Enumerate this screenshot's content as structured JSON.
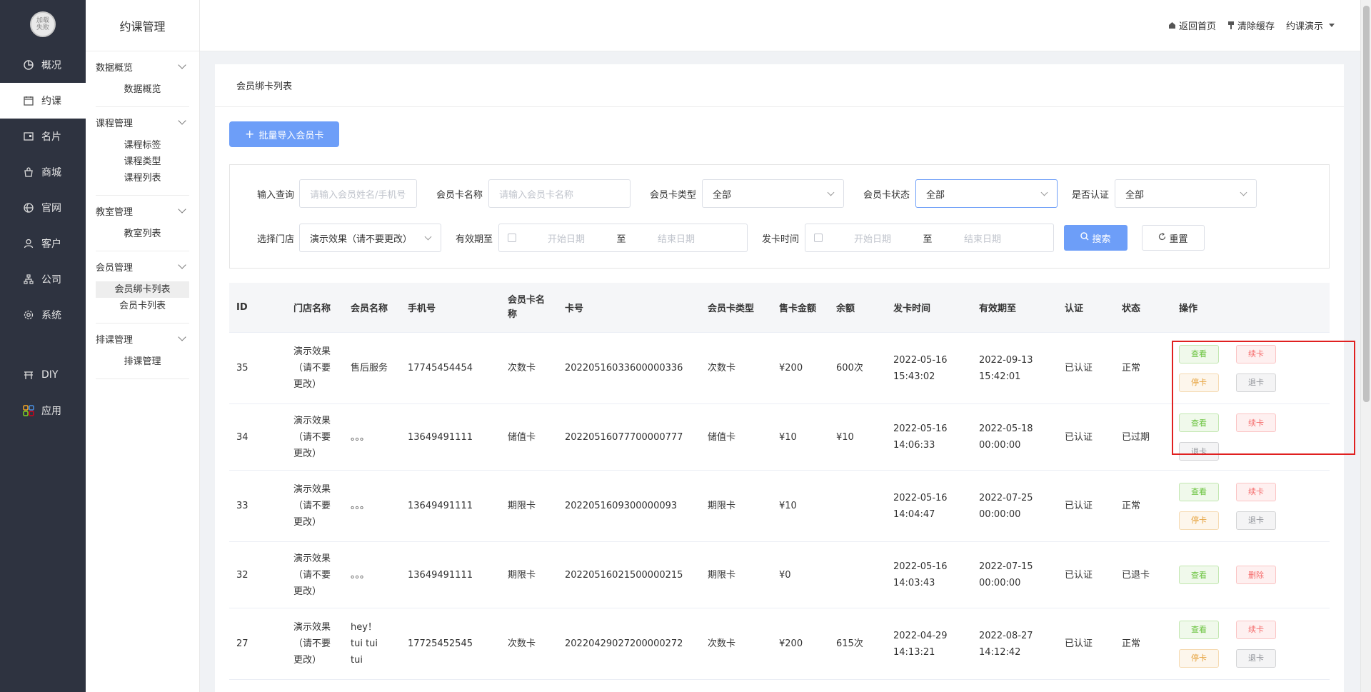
{
  "nav": {
    "logo_text": "加载\n失败",
    "items": [
      {
        "label": "概况",
        "icon": "pie-chart-icon"
      },
      {
        "label": "约课",
        "icon": "calendar-icon"
      },
      {
        "label": "名片",
        "icon": "card-icon"
      },
      {
        "label": "商城",
        "icon": "shop-icon"
      },
      {
        "label": "官网",
        "icon": "globe-icon"
      },
      {
        "label": "客户",
        "icon": "user-icon"
      },
      {
        "label": "公司",
        "icon": "org-icon"
      },
      {
        "label": "系统",
        "icon": "gear-icon"
      },
      {
        "label": "DIY",
        "icon": "diy-icon"
      },
      {
        "label": "应用",
        "icon": "apps-icon"
      }
    ],
    "active": "约课"
  },
  "subnav": {
    "title": "约课管理",
    "groups": [
      {
        "label": "数据概览",
        "items": [
          "数据概览"
        ]
      },
      {
        "label": "课程管理",
        "items": [
          "课程标签",
          "课程类型",
          "课程列表"
        ]
      },
      {
        "label": "教室管理",
        "items": [
          "教室列表"
        ]
      },
      {
        "label": "会员管理",
        "items": [
          "会员绑卡列表",
          "会员卡列表"
        ]
      },
      {
        "label": "排课管理",
        "items": [
          "排课管理"
        ]
      }
    ],
    "active_item": "会员绑卡列表"
  },
  "header": {
    "home": "返回首页",
    "clear_cache": "清除缓存",
    "user": "约课演示"
  },
  "page": {
    "title": "会员绑卡列表",
    "import_button": "批量导入会员卡"
  },
  "filters": {
    "query_label": "输入查询",
    "query_placeholder": "请输入会员姓名/手机号",
    "card_name_label": "会员卡名称",
    "card_name_placeholder": "请输入会员卡名称",
    "card_type_label": "会员卡类型",
    "card_type_value": "全部",
    "card_status_label": "会员卡状态",
    "card_status_value": "全部",
    "verified_label": "是否认证",
    "verified_value": "全部",
    "store_label": "选择门店",
    "store_value": "演示效果（请不要更改）",
    "valid_label": "有效期至",
    "issue_label": "发卡时间",
    "start_placeholder": "开始日期",
    "to": "至",
    "end_placeholder": "结束日期",
    "search_button": "搜索",
    "reset_button": "重置"
  },
  "table": {
    "headers": [
      "ID",
      "门店名称",
      "会员名称",
      "手机号",
      "会员卡名称",
      "卡号",
      "会员卡类型",
      "售卡金额",
      "余额",
      "发卡时间",
      "有效期至",
      "认证",
      "状态",
      "操作"
    ],
    "rows": [
      {
        "id": "35",
        "store": "演示效果（请不要更改）",
        "member": "售后服务",
        "phone": "17745454454",
        "card_name": "次数卡",
        "card_no": "20220516033600000336",
        "card_type": "次数卡",
        "price": "¥200",
        "balance": "600次",
        "issued": "2022-05-16 15:43:02",
        "valid": "2022-09-13 15:42:01",
        "verified": "已认证",
        "status": "正常",
        "ops": [
          "查看",
          "续卡",
          "停卡",
          "退卡"
        ]
      },
      {
        "id": "34",
        "store": "演示效果（请不要更改）",
        "member": "。。。",
        "phone": "13649491111",
        "card_name": "储值卡",
        "card_no": "20220516077700000777",
        "card_type": "储值卡",
        "price": "¥10",
        "balance": "¥10",
        "issued": "2022-05-16 14:06:33",
        "valid": "2022-05-18 00:00:00",
        "verified": "已认证",
        "status": "已过期",
        "ops": [
          "查看",
          "续卡",
          "退卡"
        ]
      },
      {
        "id": "33",
        "store": "演示效果（请不要更改）",
        "member": "。。。",
        "phone": "13649491111",
        "card_name": "期限卡",
        "card_no": "2022051609300000093",
        "card_type": "期限卡",
        "price": "¥10",
        "balance": "",
        "issued": "2022-05-16 14:04:47",
        "valid": "2022-07-25 00:00:00",
        "verified": "已认证",
        "status": "正常",
        "ops": [
          "查看",
          "续卡",
          "停卡",
          "退卡"
        ]
      },
      {
        "id": "32",
        "store": "演示效果（请不要更改）",
        "member": "。。。",
        "phone": "13649491111",
        "card_name": "期限卡",
        "card_no": "20220516021500000215",
        "card_type": "期限卡",
        "price": "¥0",
        "balance": "",
        "issued": "2022-05-16 14:03:43",
        "valid": "2022-07-15 00:00:00",
        "verified": "已认证",
        "status": "已退卡",
        "ops": [
          "查看",
          "删除"
        ]
      },
      {
        "id": "27",
        "store": "演示效果（请不要更改）",
        "member": "hey！ tui tui tui",
        "phone": "17725452545",
        "card_name": "次数卡",
        "card_no": "20220429027200000272",
        "card_type": "次数卡",
        "price": "¥200",
        "balance": "615次",
        "issued": "2022-04-29 14:13:21",
        "valid": "2022-08-27 14:12:42",
        "verified": "已认证",
        "status": "正常",
        "ops": [
          "查看",
          "续卡",
          "停卡",
          "退卡"
        ]
      }
    ]
  },
  "colors": {
    "nav_bg": "#2e3340",
    "primary": "#6d9ef8",
    "highlight": "#e02020"
  }
}
